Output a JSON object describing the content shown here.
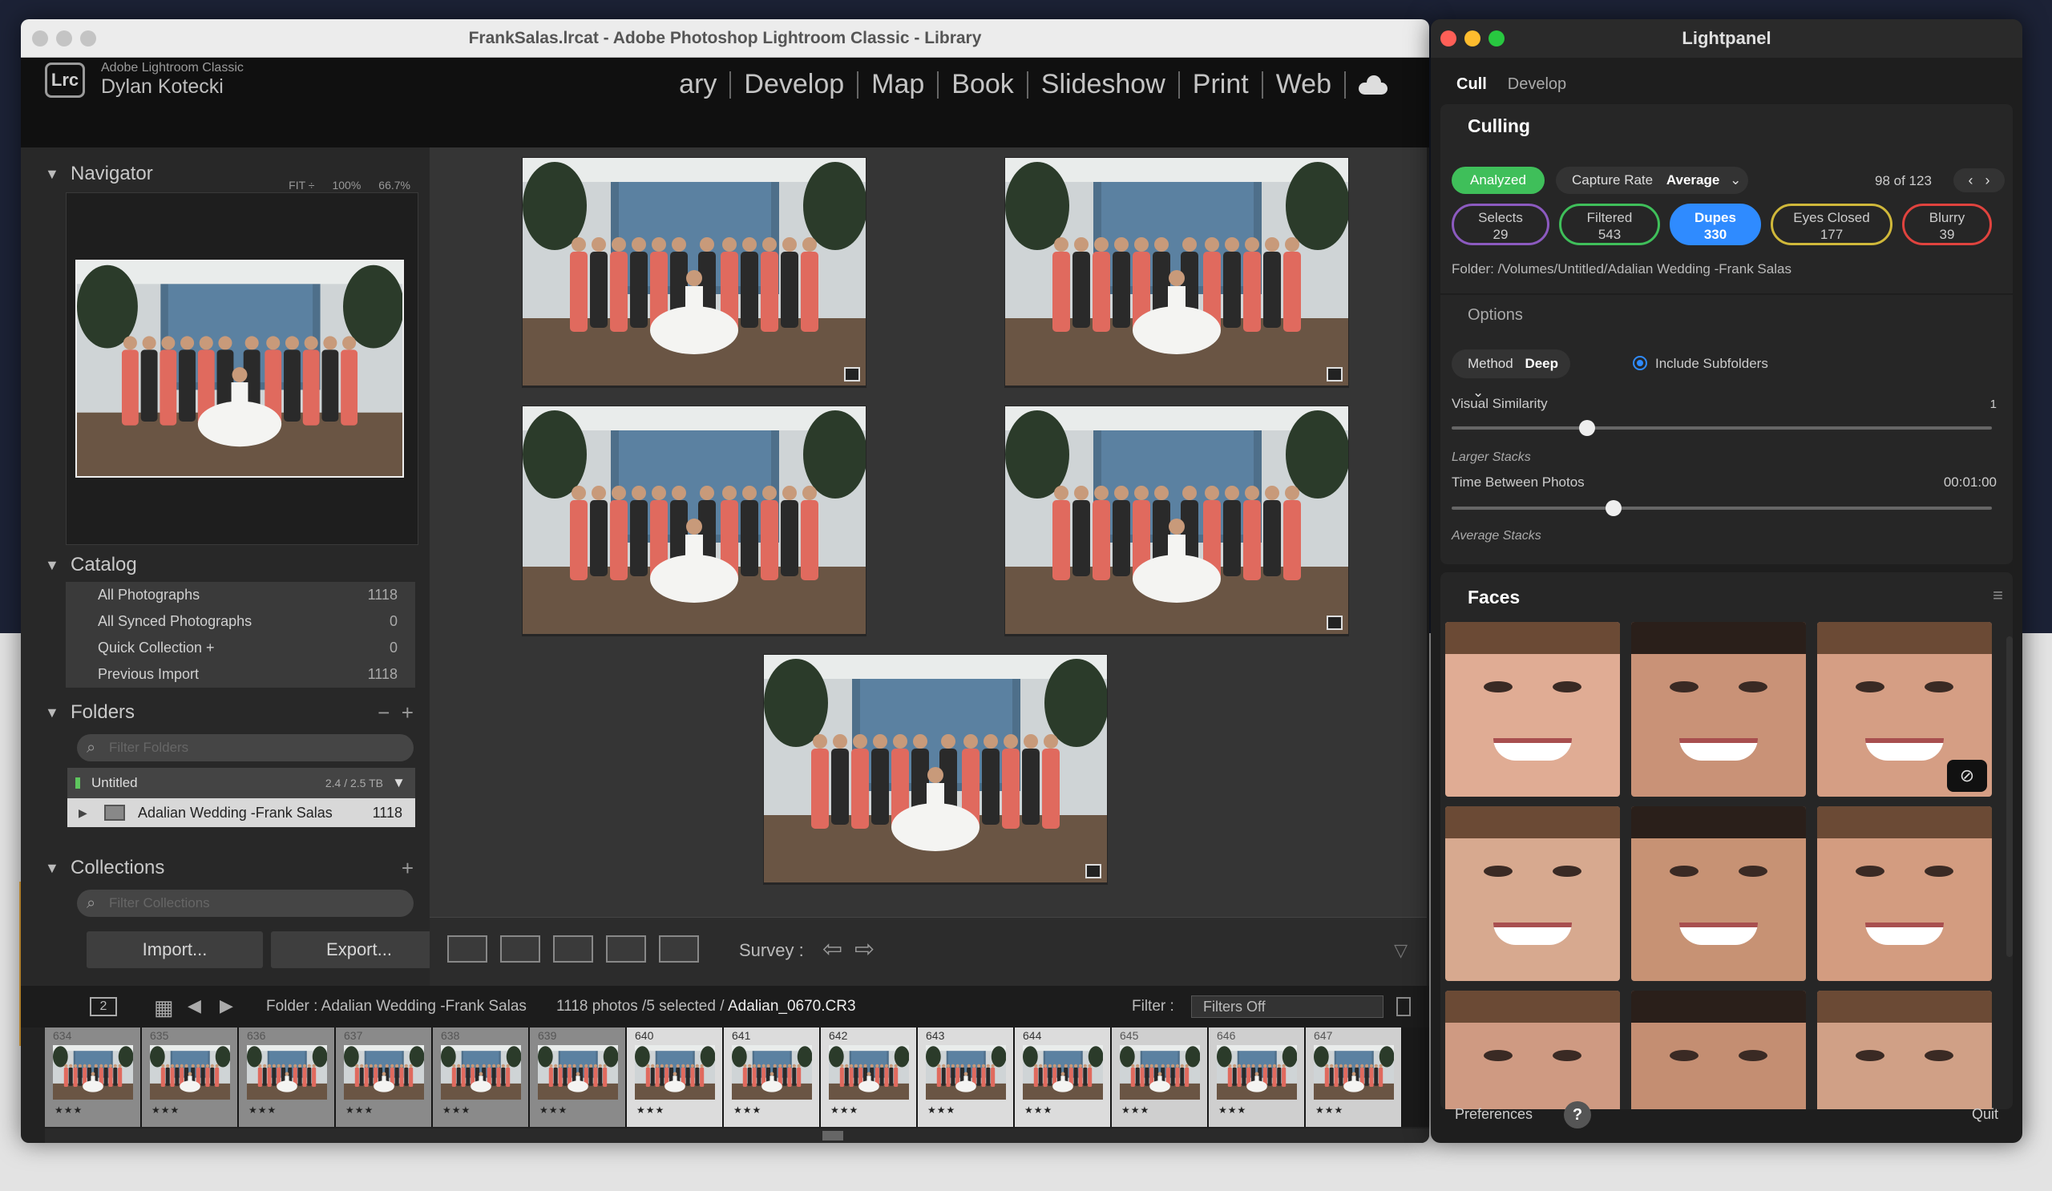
{
  "lightroom": {
    "window_title": "FrankSalas.lrcat - Adobe Photoshop Lightroom Classic - Library",
    "brand": "Adobe Lightroom Classic",
    "logo": "Lrc",
    "user": "Dylan Kotecki",
    "modules": [
      "ary",
      "Develop",
      "Map",
      "Book",
      "Slideshow",
      "Print",
      "Web"
    ],
    "navigator": {
      "title": "Navigator",
      "zoom": [
        "FIT ÷",
        "100%",
        "66.7%"
      ]
    },
    "catalog": {
      "title": "Catalog",
      "items": [
        {
          "label": "All Photographs",
          "count": "1118"
        },
        {
          "label": "All Synced Photographs",
          "count": "0"
        },
        {
          "label": "Quick Collection +",
          "count": "0"
        },
        {
          "label": "Previous Import",
          "count": "1118"
        }
      ]
    },
    "folders": {
      "title": "Folders",
      "filter_placeholder": "Filter Folders",
      "drive": {
        "label": "Untitled",
        "size": "2.4 / 2.5 TB"
      },
      "folder": {
        "label": "Adalian Wedding -Frank Salas",
        "count": "1118"
      }
    },
    "collections": {
      "title": "Collections",
      "filter_placeholder": "Filter Collections"
    },
    "import_label": "Import...",
    "export_label": "Export...",
    "toolbar": {
      "survey_label": "Survey :"
    },
    "filmstrip_header": {
      "page_num": "2",
      "source": "Folder : Adalian Wedding -Frank Salas",
      "count": "1118 photos /5 selected /",
      "file": "Adalian_0670.CR3",
      "filter_label": "Filter :",
      "filter_value": "Filters Off"
    },
    "filmstrip": [
      "634",
      "635",
      "636",
      "637",
      "638",
      "639",
      "640",
      "641",
      "642",
      "643",
      "644",
      "645",
      "646",
      "647"
    ]
  },
  "lightpanel": {
    "title": "Lightpanel",
    "tabs": [
      "Cull",
      "Develop"
    ],
    "section": "Culling",
    "analyzed": "Analyzed",
    "capture_rate_label": "Capture Rate",
    "capture_rate_value": "Average",
    "position": "98 of 123",
    "pills": [
      {
        "label": "Selects",
        "count": "29"
      },
      {
        "label": "Filtered",
        "count": "543"
      },
      {
        "label": "Dupes",
        "count": "330"
      },
      {
        "label": "Eyes Closed",
        "count": "177"
      },
      {
        "label": "Blurry",
        "count": "39"
      }
    ],
    "folder": "Folder:  /Volumes/Untitled/Adalian Wedding -Frank Salas",
    "options_title": "Options",
    "method_label": "Method",
    "method_value": "Deep",
    "include_subfolders": "Include Subfolders",
    "visual_similarity": {
      "label": "Visual Similarity",
      "value": "1",
      "level": 0.25
    },
    "larger_stacks": "Larger Stacks",
    "time_between": {
      "label": "Time Between Photos",
      "value": "00:01:00",
      "level": 0.3
    },
    "average_stacks": "Average Stacks",
    "faces_title": "Faces",
    "preferences": "Preferences",
    "help": "?",
    "quit": "Quit",
    "colors": {
      "green": "#3fbf5a",
      "blue": "#2f8bff",
      "yellow": "#d0b83a",
      "red": "#e0433e",
      "purple": "#8c5ac0"
    }
  }
}
